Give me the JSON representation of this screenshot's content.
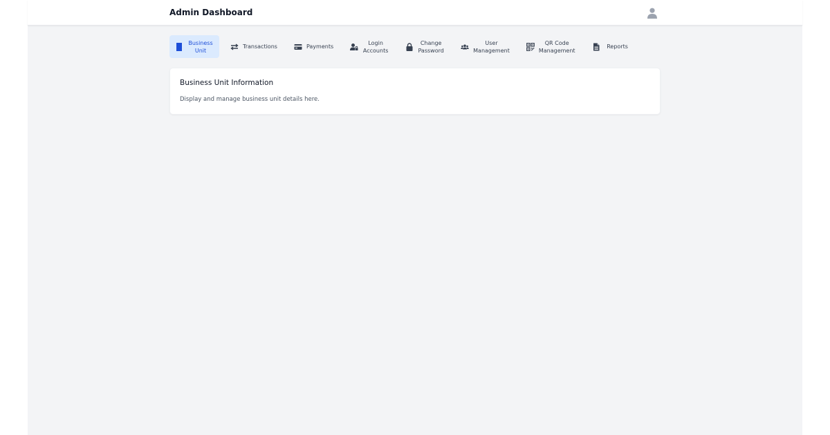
{
  "header": {
    "title": "Admin Dashboard",
    "user_icon": "user-icon"
  },
  "nav": {
    "items": [
      {
        "label": "Business\nUnit",
        "icon": "building-icon",
        "active": true
      },
      {
        "label": "Transactions",
        "icon": "exchange-icon",
        "active": false
      },
      {
        "label": "Payments",
        "icon": "credit-card-icon",
        "active": false
      },
      {
        "label": "Login\nAccounts",
        "icon": "user-lock-icon",
        "active": false
      },
      {
        "label": "Change\nPassword",
        "icon": "lock-icon",
        "active": false
      },
      {
        "label": "User\nManagement",
        "icon": "users-icon",
        "active": false
      },
      {
        "label": "QR Code\nManagement",
        "icon": "qrcode-icon",
        "active": false
      },
      {
        "label": "Reports",
        "icon": "file-icon",
        "active": false
      }
    ]
  },
  "main": {
    "card_title": "Business Unit Information",
    "card_description": "Display and manage business unit details here."
  },
  "colors": {
    "accent": "#1d4ed8",
    "accent_bg": "#dbeafe",
    "page_bg": "#f3f4f6"
  }
}
